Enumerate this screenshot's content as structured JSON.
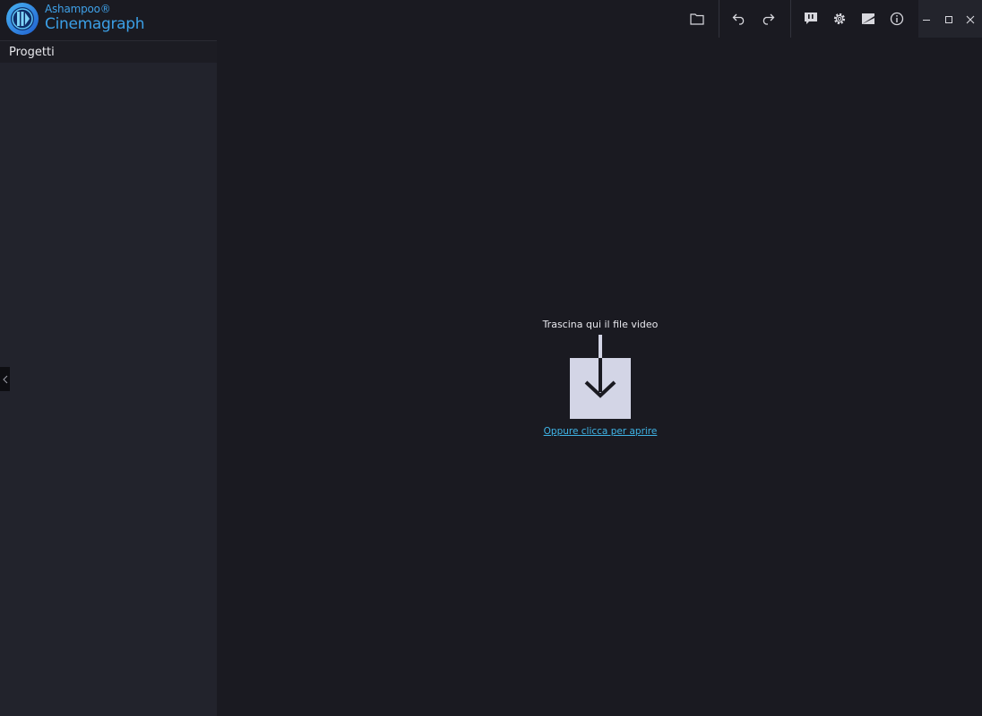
{
  "app": {
    "brand_top": "Ashampoo®",
    "brand_name": "Cinemagraph"
  },
  "toolbar": {
    "icons": [
      "folder-open-icon",
      "undo-icon",
      "redo-icon",
      "feedback-icon",
      "settings-icon",
      "display-icon",
      "info-icon"
    ]
  },
  "window_controls": [
    "minimize-icon",
    "maximize-icon",
    "close-icon"
  ],
  "sidebar": {
    "title": "Progetti"
  },
  "drop_zone": {
    "label": "Trascina qui il file video",
    "link": "Oppure clicca per aprire"
  },
  "colors": {
    "background": "#1a1a21",
    "sidebar": "#22232c",
    "accent": "#3fb4e6",
    "drop_box": "#d3d5e6"
  }
}
